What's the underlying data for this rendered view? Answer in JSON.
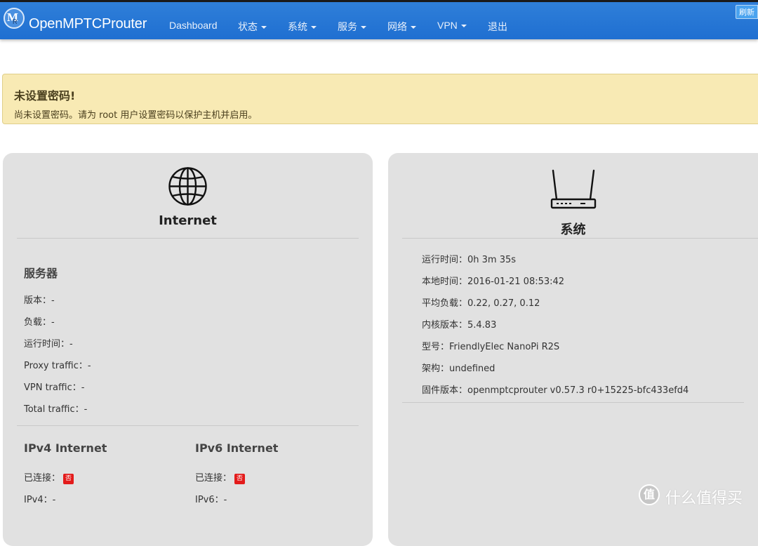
{
  "navbar": {
    "brand": "OpenMPTCProuter",
    "logo_letters": "MR",
    "items": [
      {
        "label": "Dashboard"
      },
      {
        "label": "状态"
      },
      {
        "label": "系统"
      },
      {
        "label": "服务"
      },
      {
        "label": "网络"
      },
      {
        "label": "VPN"
      },
      {
        "label": "退出"
      }
    ],
    "refresh_label": "刷新",
    "color": "#2a79d6"
  },
  "alert": {
    "title": "未设置密码!",
    "text": "尚未设置密码。请为 root 用户设置密码以保护主机并启用。",
    "color": "#f8eab4"
  },
  "internet_panel": {
    "icon": "globe-icon",
    "title": "Internet",
    "server_title": "服务器",
    "server_rows": [
      "版本：-",
      "负载：-",
      "运行时间：-",
      "Proxy traffic：-",
      "VPN traffic：-",
      "Total traffic：-"
    ],
    "ipv4": {
      "title": "IPv4 Internet",
      "connected_label": "已连接：",
      "connected_badge": "否",
      "address_row": "IPv4：-"
    },
    "ipv6": {
      "title": "IPv6 Internet",
      "connected_label": "已连接：",
      "connected_badge": "否",
      "address_row": "IPv6：-"
    }
  },
  "system_panel": {
    "icon": "router-icon",
    "title": "系统",
    "rows": [
      "运行时间：0h 3m 35s",
      "本地时间：2016-01-21 08:53:42",
      "平均负载：0.22, 0.27, 0.12",
      "内核版本：5.4.83",
      "型号：FriendlyElec NanoPi R2S",
      "架构：undefined",
      "固件版本：openmptcprouter v0.57.3 r0+15225-bfc433efd4"
    ]
  },
  "watermark": {
    "icon_letter": "值",
    "text": "什么值得买"
  }
}
